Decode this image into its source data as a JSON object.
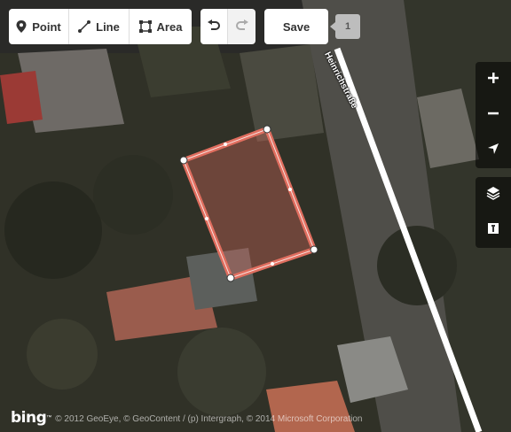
{
  "toolbar": {
    "modes": [
      {
        "label": "Point",
        "icon": "marker-icon"
      },
      {
        "label": "Line",
        "icon": "line-icon"
      },
      {
        "label": "Area",
        "icon": "area-icon"
      }
    ],
    "undo_icon": "undo-icon",
    "redo_icon": "redo-icon",
    "save_label": "Save",
    "edit_count": "1"
  },
  "map_controls": {
    "zoom": [
      "zoom-in-icon",
      "zoom-out-icon",
      "geolocate-icon"
    ],
    "panels": [
      "layers-icon",
      "map-data-icon"
    ]
  },
  "map": {
    "street_name": "Heinrichstraße",
    "attribution_logo": "bing",
    "attribution": "© 2012 GeoEye, © GeoContent / (p) Intergraph, © 2014 Microsoft Corporation",
    "colors": {
      "area_stroke": "#e06e5f",
      "road": "#ffffff",
      "vertex": "#ffffff"
    }
  }
}
